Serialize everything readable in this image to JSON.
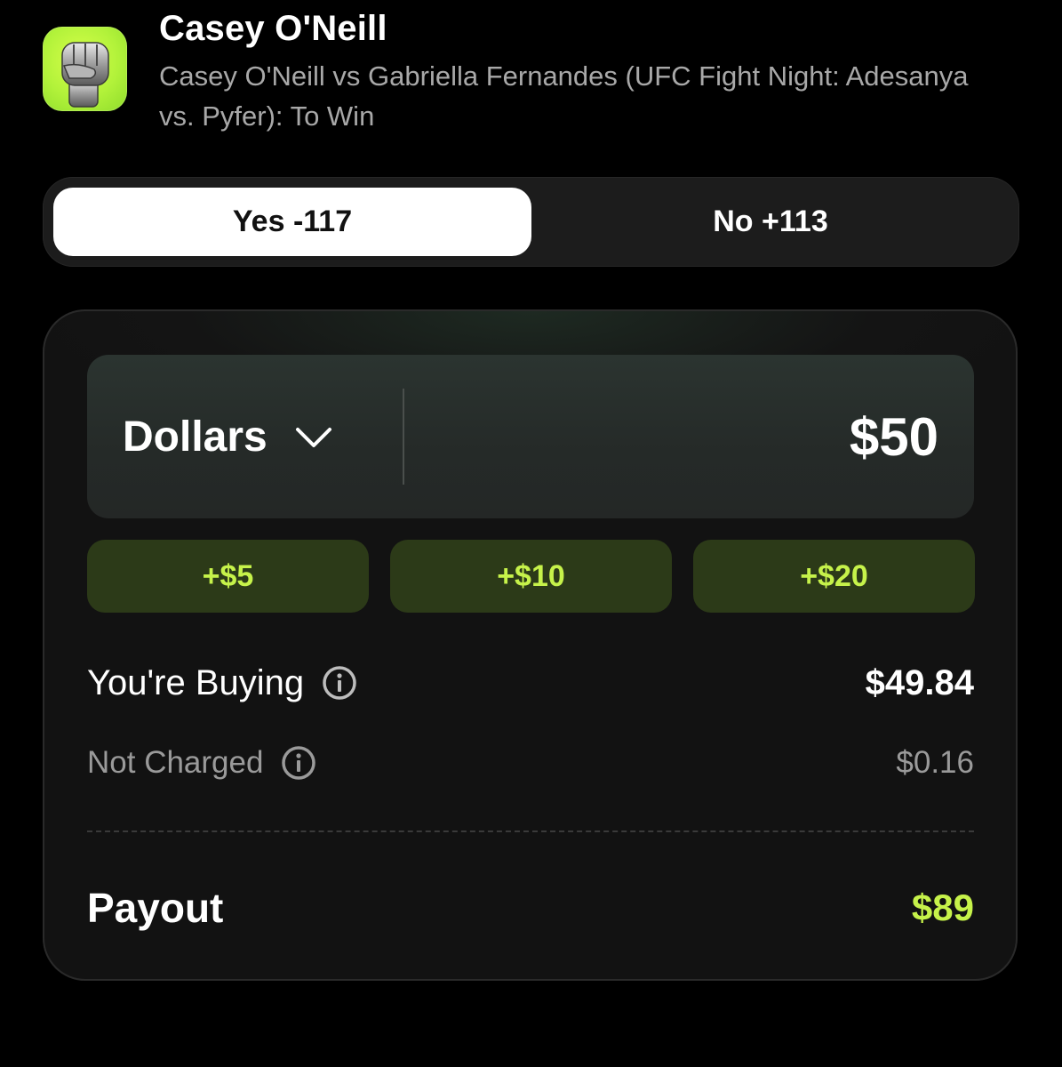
{
  "market": {
    "title": "Casey O'Neill",
    "subtitle": "Casey O'Neill vs Gabriella Fernandes (UFC Fight Night: Adesanya vs. Pyfer): To Win",
    "icon": "fist-icon"
  },
  "toggle": {
    "selected": "yes",
    "yes_label": "Yes -117",
    "no_label": "No +113"
  },
  "order": {
    "unit_label": "Dollars",
    "amount": "$50",
    "quick_adds": [
      "+$5",
      "+$10",
      "+$20"
    ],
    "buying_label": "You're Buying",
    "buying_value": "$49.84",
    "not_charged_label": "Not Charged",
    "not_charged_value": "$0.16",
    "payout_label": "Payout",
    "payout_value": "$89"
  },
  "colors": {
    "background": "#000000",
    "accent_green": "#c6f24a",
    "quick_button_bg": "#2c3a18",
    "selected_toggle_bg": "#ffffff"
  }
}
